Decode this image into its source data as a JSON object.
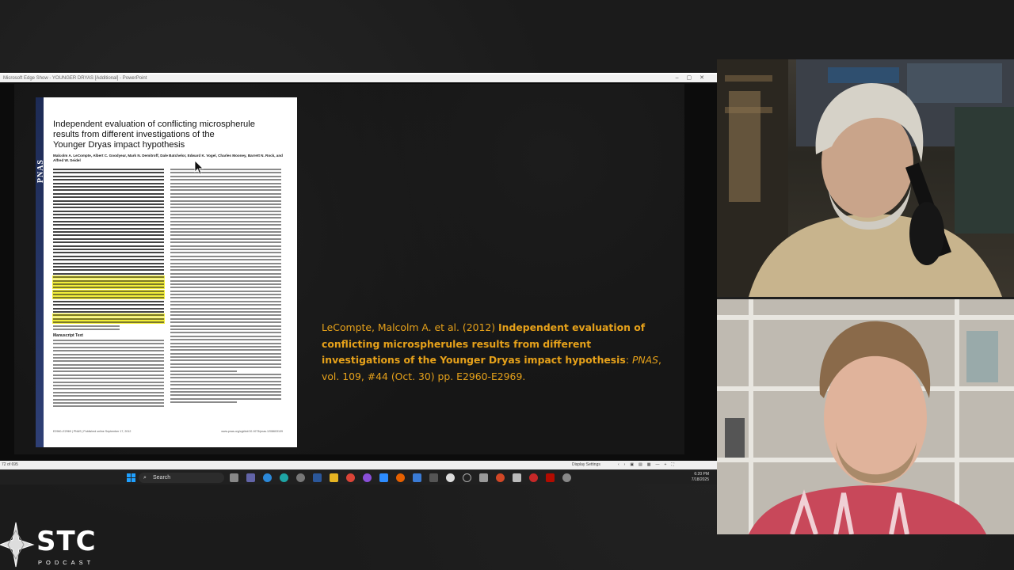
{
  "window": {
    "title": "Microsoft Edge Show - YOUNGER DRYAS [Additional] - PowerPoint"
  },
  "slide": {
    "paper": {
      "journal": "PNAS",
      "title_lines": [
        "Independent evaluation of conflicting microspherule",
        "results from different investigations of the",
        "Younger Dryas impact hypothesis"
      ],
      "authors": "Malcolm A. LeCompte, Albert C. Goodyear, Mark N. Demitroff, Dale Batchelor, Edward K. Vogel, Charles Mooney, Barrett N. Rock, and Alfred W. Seidel",
      "section_heading": "Manuscript Text",
      "footer_left": "E2960–E2969 | PNAS | Published online September 17, 2012",
      "footer_right": "www.pnas.org/cgi/doi/10.1073/pnas.1208603109"
    },
    "citation": {
      "prefix": "LeCompte, Malcolm A. et al. (2012) ",
      "bold_title": "Independent evaluation of conflicting microspherules results from different investigations of the Younger Dryas impact hypothesis",
      "colon": ": ",
      "journal": "PNAS",
      "details": ", vol. 109, #44 (Oct. 30) pp. E2960-E2969."
    },
    "accent_color": "#e6a11a"
  },
  "statusbar": {
    "slide_count": "72 of 695",
    "display_settings": "Display Settings"
  },
  "taskbar": {
    "search_placeholder": "Search",
    "time": "6:20 PM",
    "date": "7/18/2025"
  },
  "logo": {
    "name": "STC",
    "tagline": "PODCAST"
  }
}
